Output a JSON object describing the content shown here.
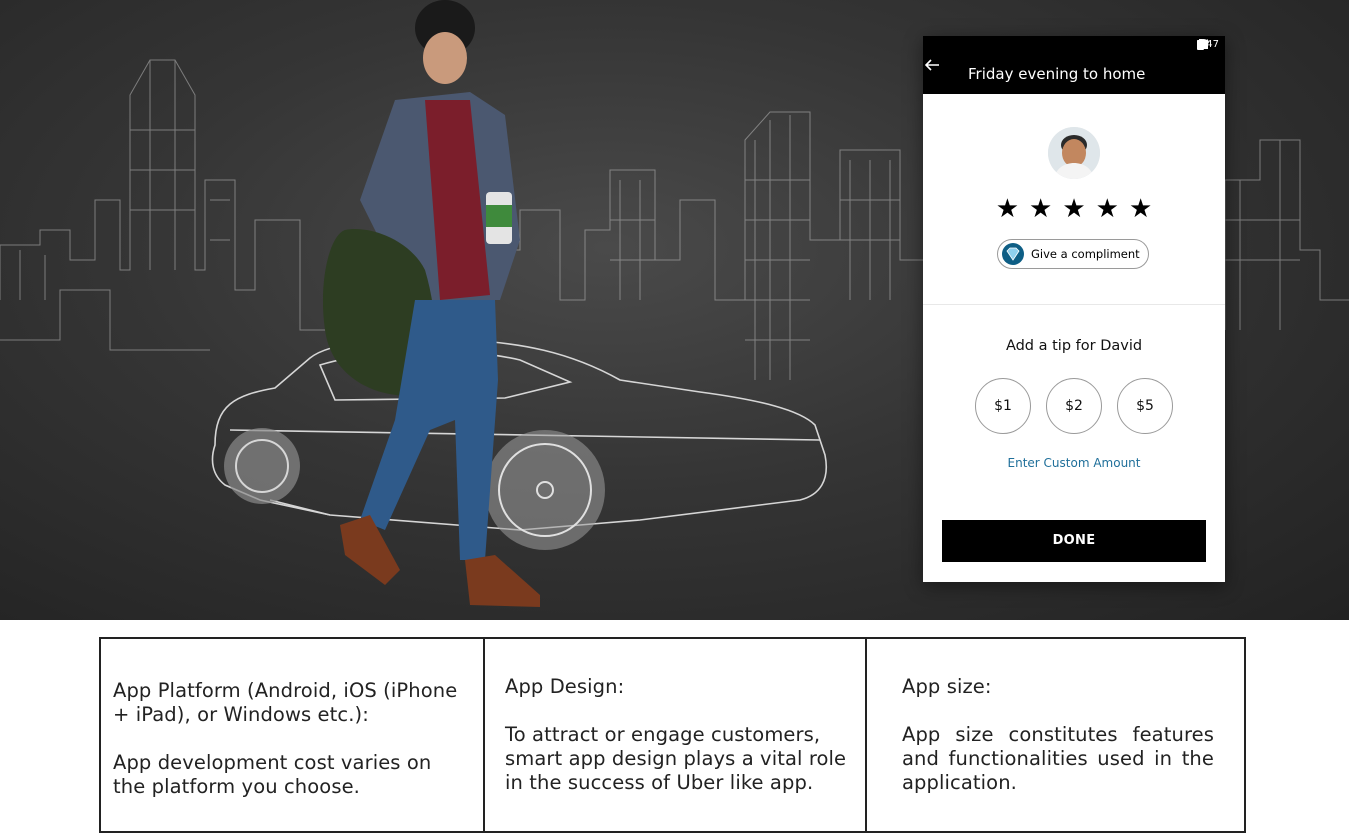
{
  "phone": {
    "status_time": "7:47",
    "title": "Friday evening to home",
    "rating_stars": 5,
    "compliment_label": "Give a compliment",
    "tip_heading": "Add a tip for David",
    "tip_options": [
      "$1",
      "$2",
      "$5"
    ],
    "custom_amount_label": "Enter Custom Amount",
    "done_label": "DONE"
  },
  "info": [
    {
      "heading": "App Platform (Android, iOS (iPhone + iPad), or Windows etc.):",
      "body": "App development cost varies on the platform you choose."
    },
    {
      "heading": "App Design:",
      "body": "To attract or engage customers, smart app design plays a vital role in the success of Uber like app."
    },
    {
      "heading": "App size:",
      "body": "App size constitutes features and functionalities used in the application."
    }
  ]
}
